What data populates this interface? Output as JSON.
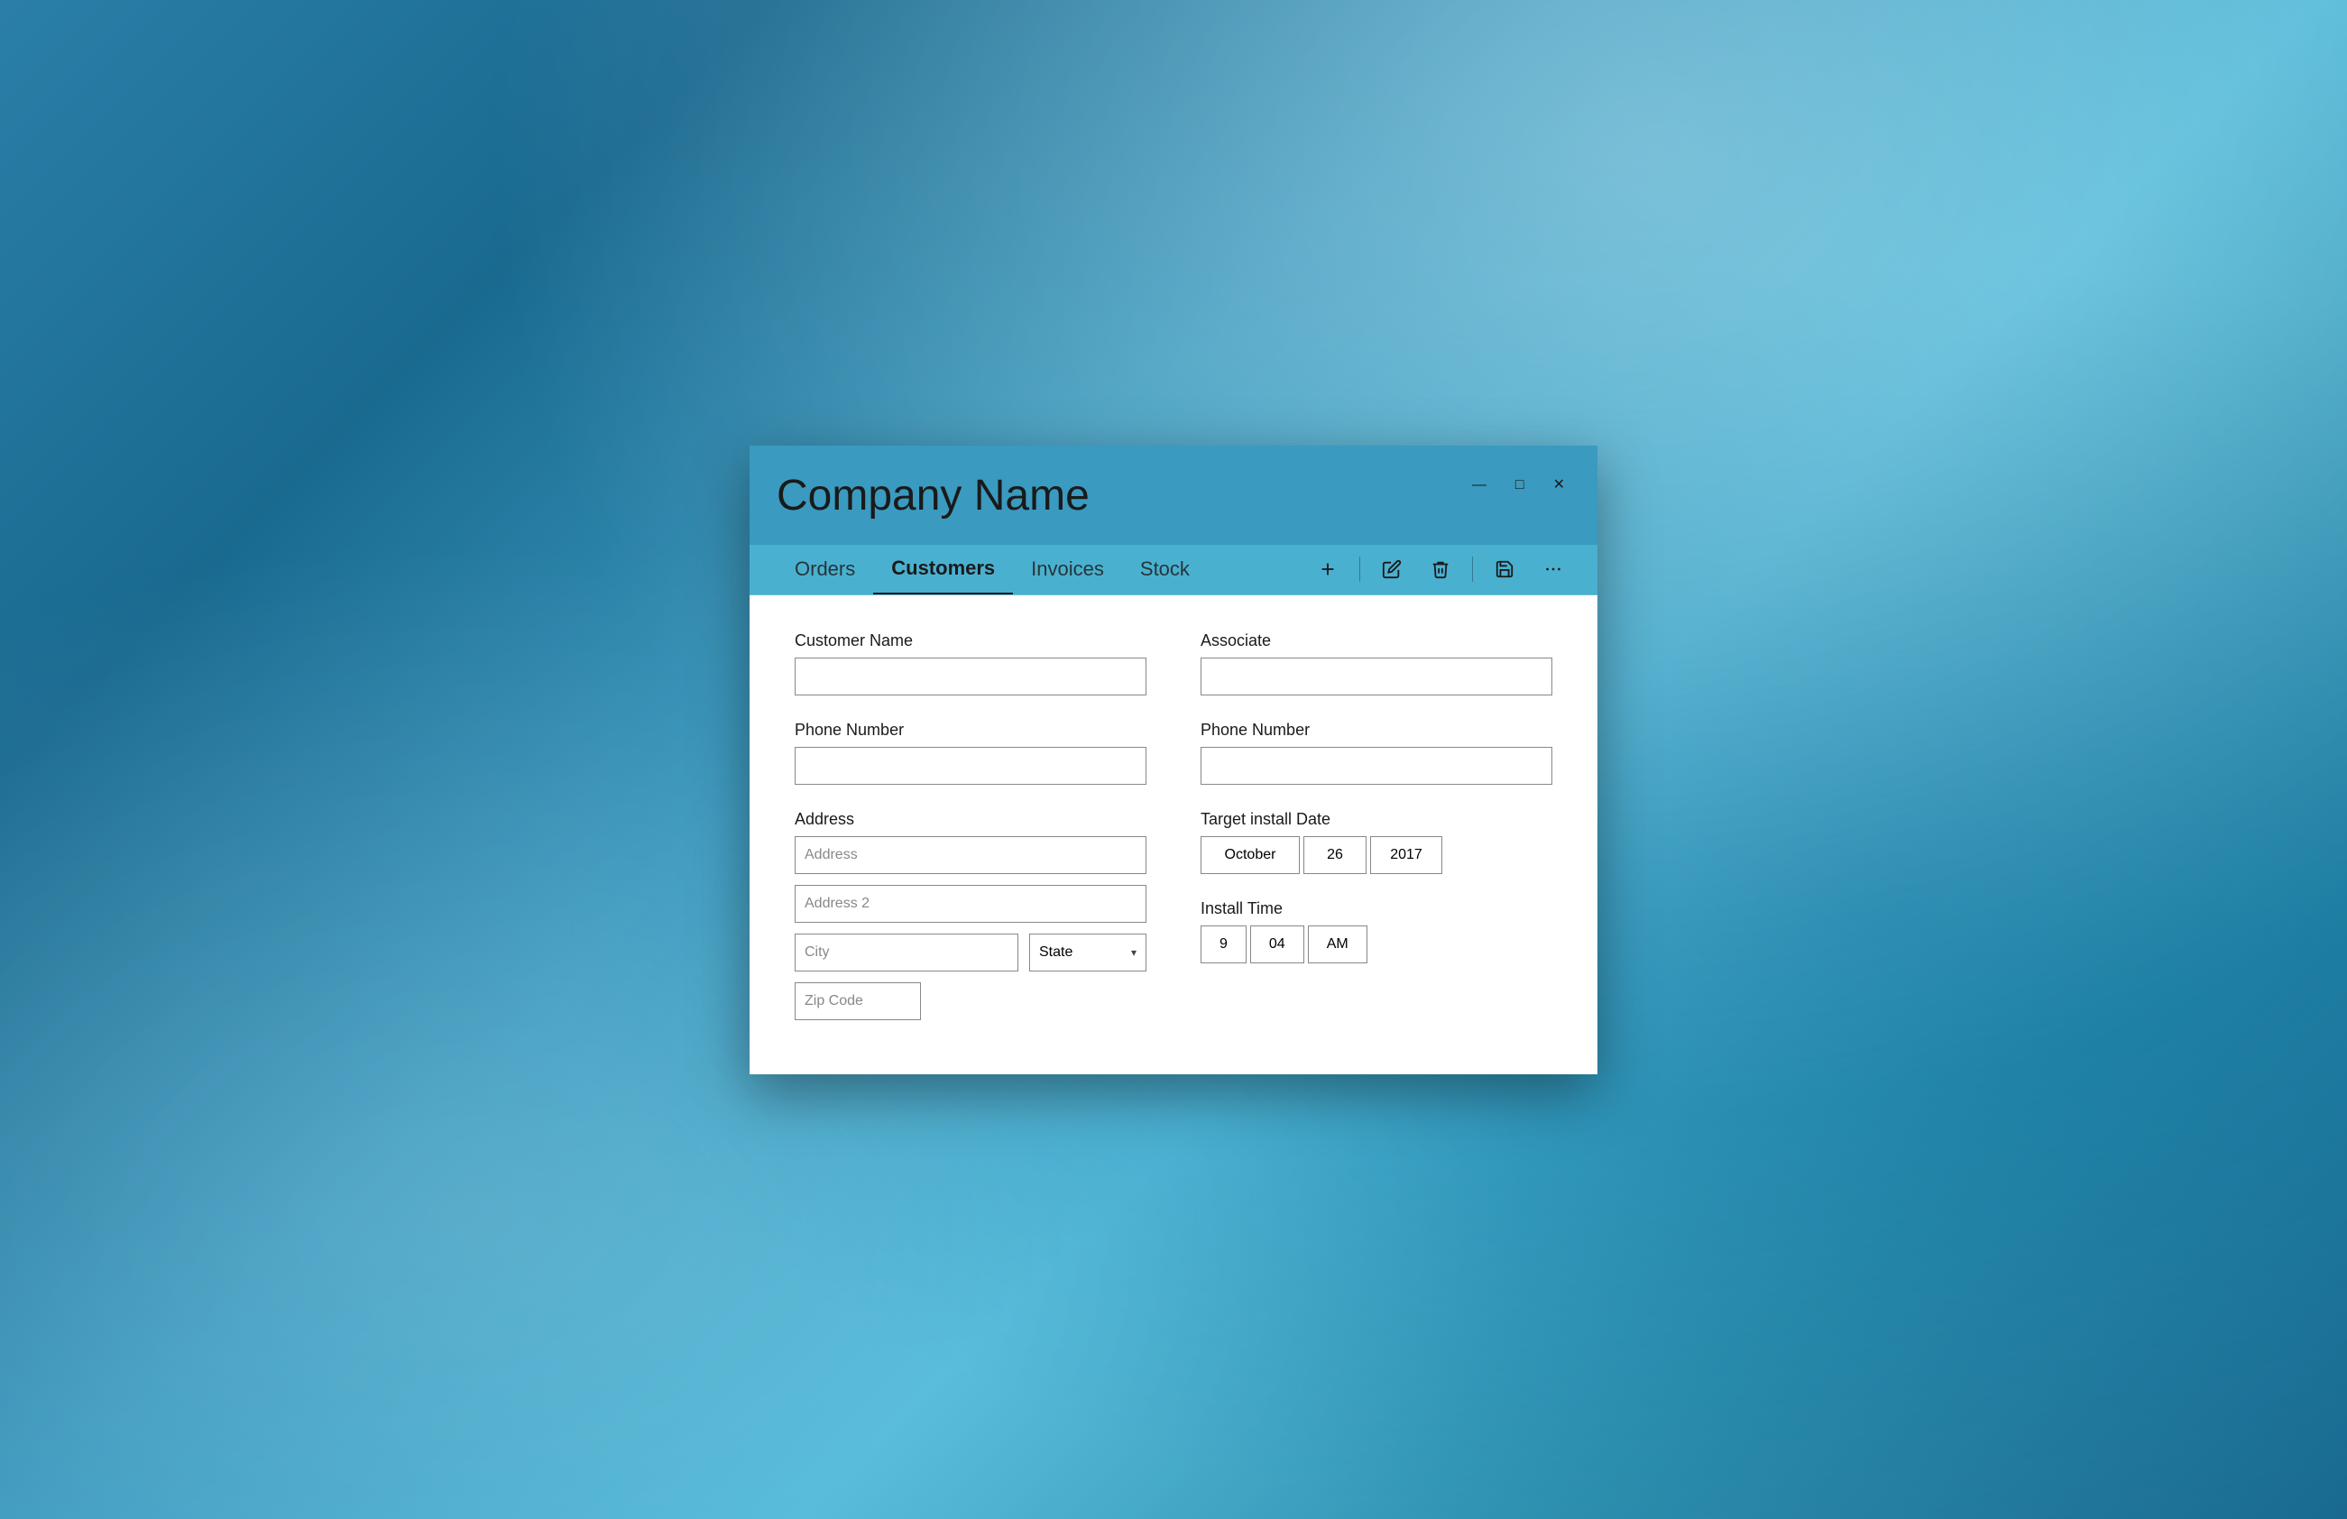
{
  "window": {
    "title": "Company Name",
    "controls": {
      "minimize": "—",
      "maximize": "□",
      "close": "✕"
    }
  },
  "navbar": {
    "tabs": [
      {
        "id": "orders",
        "label": "Orders",
        "active": false
      },
      {
        "id": "customers",
        "label": "Customers",
        "active": true
      },
      {
        "id": "invoices",
        "label": "Invoices",
        "active": false
      },
      {
        "id": "stock",
        "label": "Stock",
        "active": false
      }
    ],
    "toolbar": {
      "add_label": "+",
      "more_label": "···"
    }
  },
  "form": {
    "left": {
      "customer_name": {
        "label": "Customer Name",
        "value": "",
        "placeholder": ""
      },
      "phone_number": {
        "label": "Phone Number",
        "value": "",
        "placeholder": ""
      },
      "address": {
        "label": "Address",
        "address1_placeholder": "Address",
        "address2_placeholder": "Address 2",
        "city_placeholder": "City",
        "state_placeholder": "State",
        "zip_placeholder": "Zip Code"
      }
    },
    "right": {
      "associate": {
        "label": "Associate",
        "value": "",
        "placeholder": ""
      },
      "phone_number": {
        "label": "Phone Number",
        "value": "",
        "placeholder": ""
      },
      "target_install_date": {
        "label": "Target install Date",
        "month": "October",
        "day": "26",
        "year": "2017"
      },
      "install_time": {
        "label": "Install Time",
        "hour": "9",
        "minute": "04",
        "ampm": "AM"
      }
    }
  }
}
